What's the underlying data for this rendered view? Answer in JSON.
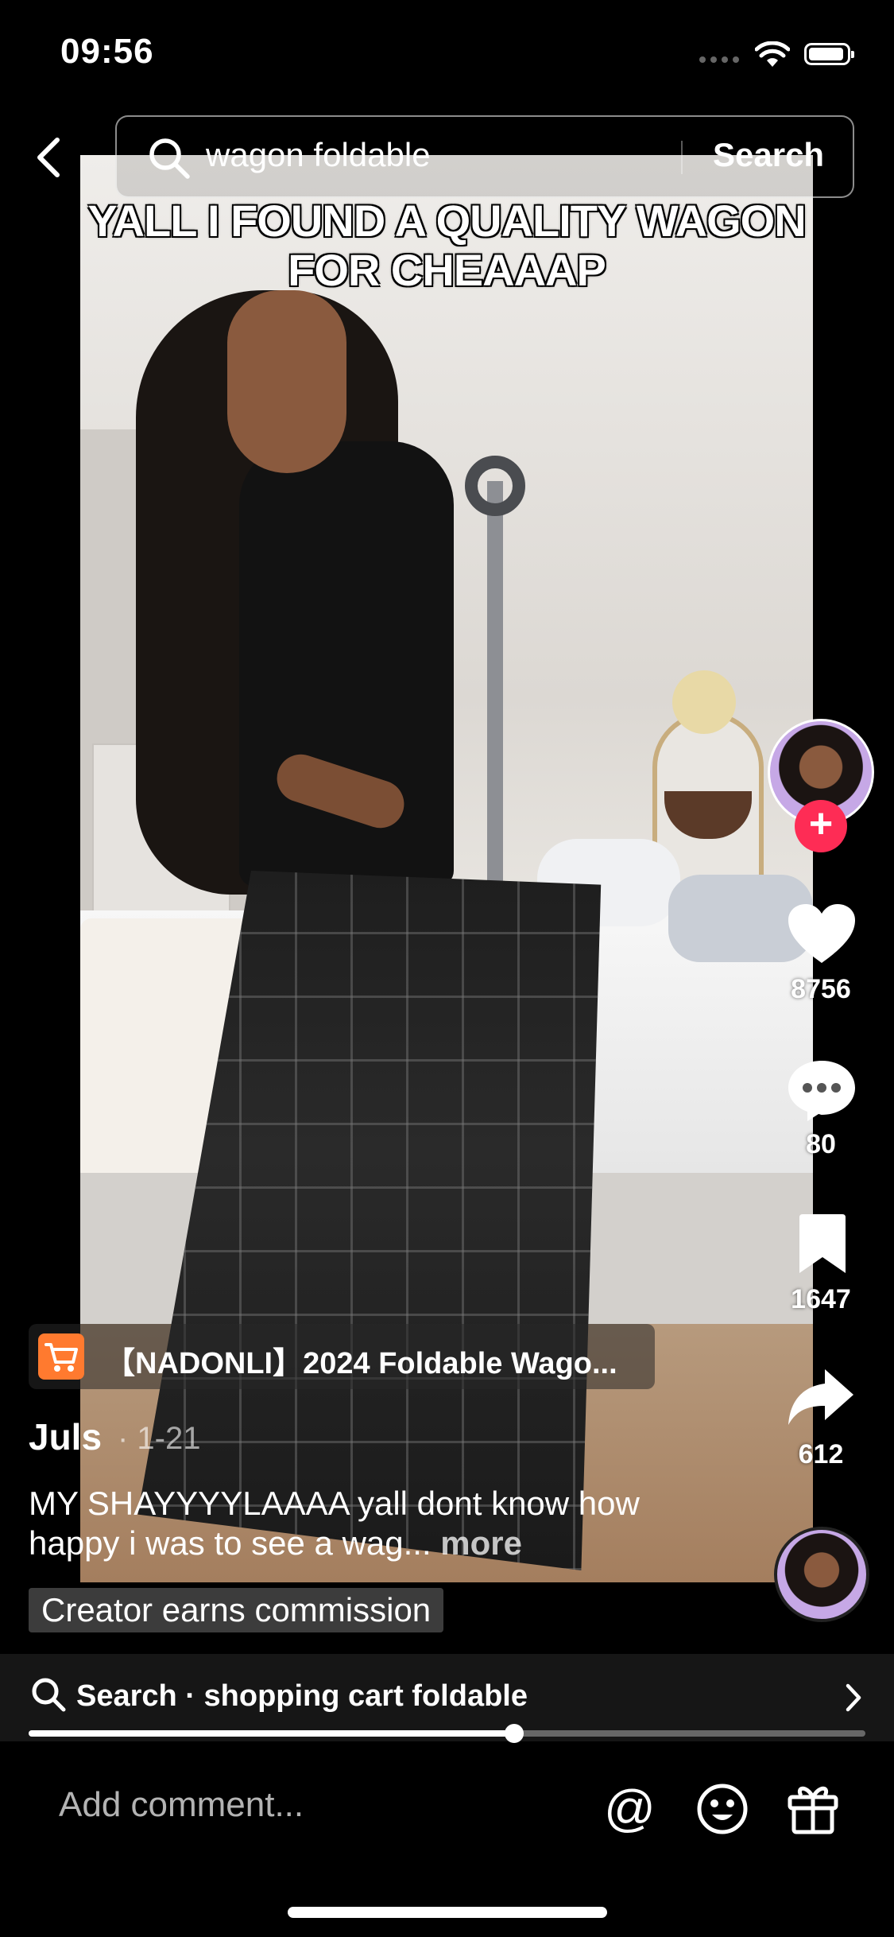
{
  "status_bar": {
    "time": "09:56"
  },
  "search": {
    "query": "wagon foldable",
    "button_label": "Search"
  },
  "video": {
    "overlay_text": "YALL I FOUND A QUALITY WAGON FOR CHEAAAP"
  },
  "actions": {
    "likes": "8756",
    "comments": "80",
    "saves": "1647",
    "shares": "612"
  },
  "product": {
    "title": "【NADONLI】2024 Foldable Wago..."
  },
  "post": {
    "creator": "Juls",
    "date": "· 1-21",
    "caption": "MY SHAYYYYLAAAA yall dont know how happy i was to see a wag...",
    "more_label": "more",
    "badge": "Creator earns commission"
  },
  "suggestion": {
    "text": "Search · shopping cart foldable"
  },
  "playback": {
    "progress": 0.58
  },
  "comment_bar": {
    "placeholder": "Add comment..."
  },
  "colors": {
    "follow": "#fe2c55",
    "cart": "#ff7a2f"
  }
}
